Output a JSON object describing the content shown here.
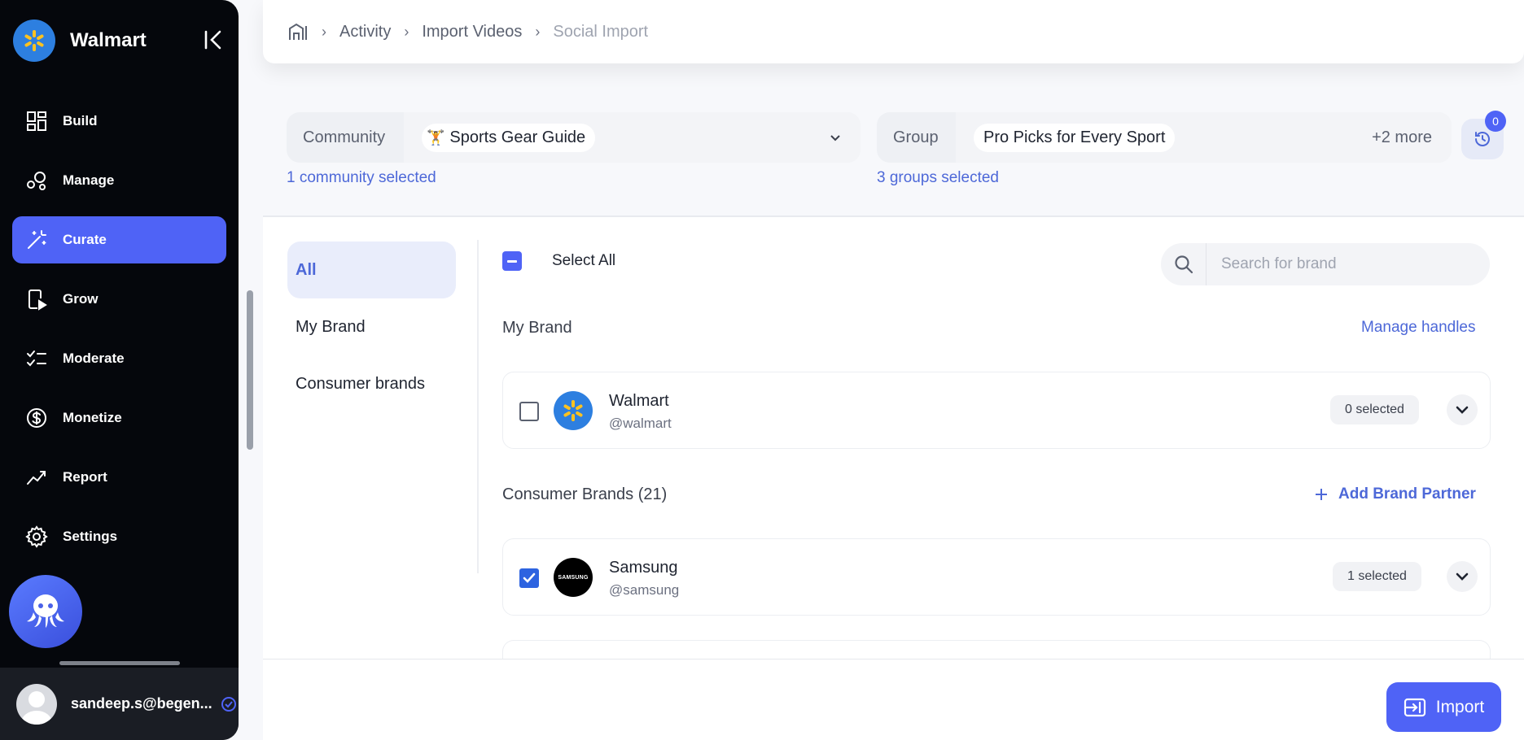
{
  "app": {
    "brand_name": "Walmart"
  },
  "sidebar": {
    "items": [
      {
        "label": "Build",
        "icon": "dashboard-icon"
      },
      {
        "label": "Manage",
        "icon": "manage-icon"
      },
      {
        "label": "Curate",
        "icon": "magic-wand-icon",
        "active": true
      },
      {
        "label": "Grow",
        "icon": "grow-icon"
      },
      {
        "label": "Moderate",
        "icon": "checklist-icon"
      },
      {
        "label": "Monetize",
        "icon": "dollar-icon"
      },
      {
        "label": "Report",
        "icon": "trend-icon"
      },
      {
        "label": "Settings",
        "icon": "gear-icon"
      }
    ],
    "user_email": "sandeep.s@begen..."
  },
  "breadcrumb": {
    "items": [
      "Activity",
      "Import Videos"
    ],
    "current": "Social Import"
  },
  "filters": {
    "community": {
      "label": "Community",
      "value": "Sports Gear Guide",
      "chip_emoji": "🏋",
      "selected_text": "1 community selected"
    },
    "group": {
      "label": "Group",
      "value": "Pro Picks for Every Sport",
      "more": "+2 more",
      "selected_text": "3 groups selected"
    },
    "history_badge": "0"
  },
  "tabs": [
    "All",
    "My Brand",
    "Consumer brands"
  ],
  "list": {
    "select_all_label": "Select All",
    "search_placeholder": "Search for brand",
    "my_brand_title": "My Brand",
    "manage_handles_label": "Manage handles",
    "consumer_title": "Consumer Brands (21)",
    "add_partner_label": "Add Brand Partner",
    "brands": [
      {
        "name": "Walmart",
        "handle": "@walmart",
        "selected": "0 selected",
        "checked": false
      },
      {
        "name": "Samsung",
        "handle": "@samsung",
        "selected": "1 selected",
        "checked": true,
        "logo_text": "SAMSUNG"
      }
    ]
  },
  "footer": {
    "import_label": "Import"
  },
  "colors": {
    "accent": "#4f63f6",
    "link": "#4d68d8",
    "sidebar_bg": "#05070c"
  }
}
